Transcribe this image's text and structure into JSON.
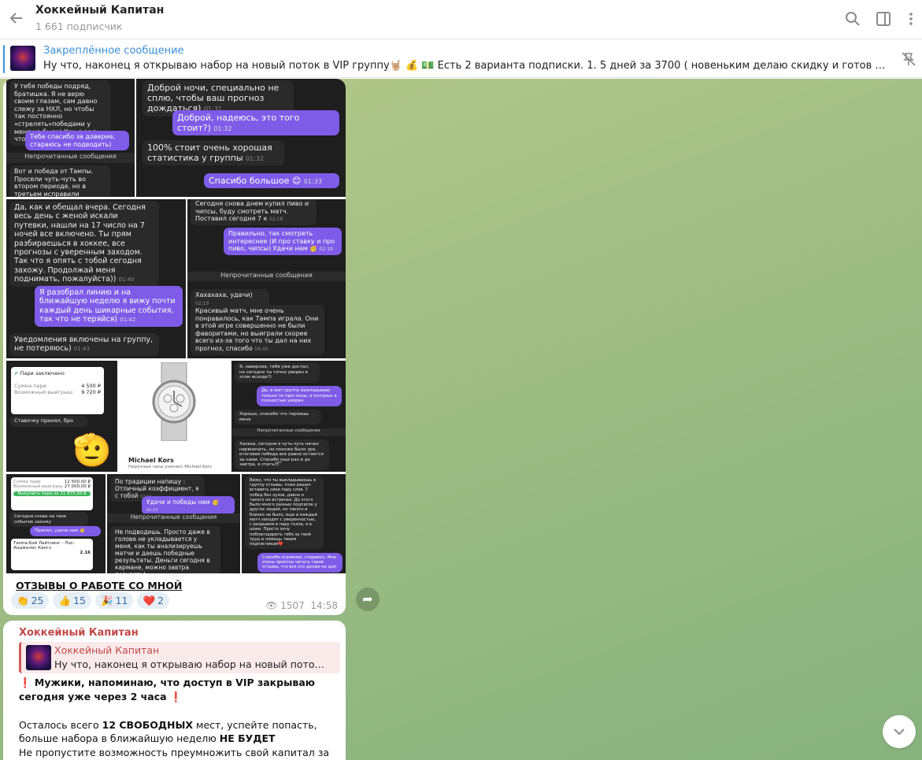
{
  "header": {
    "title": "Хоккейный Капитан",
    "subscribers": "1 661 подписчик"
  },
  "pinned": {
    "label": "Закреплённое сообщение",
    "text": "Ну что, наконец я открываю набор на новый поток в VIP группу🤘🏼 💰 💵 Есть 2 варианта подписки. 1. 5 дней за 3700 ( новеньким делаю скидку и готов дать доступ за ..."
  },
  "post1": {
    "shot1": {
      "texts": [
        "У тебя победы подряд, братишка. Я не верю своим глазам, сам давно слежу за НХЛ, но чтобы так постоянно «стрелять»победами у меня не было) Как я рад, что на тебя наткнулся)",
        "Тебе спасибо за доверие, стараюсь не подводить)",
        "Непрочитанные сообщения",
        "Вот и победа от Тампы. Просели чуть-чуть во втором периоде, но в третьем исправили ситуацию, благодарствую за прогноз"
      ]
    },
    "shot2": {
      "texts": [
        "Доброй ночи, специально не сплю, чтобы ваш прогноз дождаться)",
        "01:31",
        "Доброй, надеюсь, это того стоит?)",
        "01:32",
        "100% стоит очень хорошая статистика у группы",
        "01:32",
        "Спасибо большое 😊",
        "01:33"
      ]
    },
    "shot3": {
      "texts": [
        "Да, как и обещал вчера. Сегодня весь день с женой искали путевки, нашли на 17 число на 7 ночей все включено. Ты прям разбираешься в хоккее, все прогнозы с уверенным заходом. Так что я опять с тобой сегодня захожу. Продолжай меня поднимать, пожалуйста))",
        "01:40",
        "Я разобрал линию и на ближайшую неделю я вижу почти каждый день шикарные события, так что не теряйся)",
        "01:42",
        "Уведомления включены на группу, не потеряюсь)",
        "01:43"
      ]
    },
    "shot4": {
      "texts": [
        "Сегодня снова днем купил пиво и чипсы, буду смотреть матч. Поставил сегодня 7 к",
        "02:18",
        "Правильно, так смотреть интереснее (И про ставку и про пиво, чипсы) Удачи нам 🥳",
        "02:19",
        "Непрочитанные сообщения",
        "Хахахаха, удачи)",
        "02:19",
        "Красивый матч, мне очень понравилось, как Тампа играла. Они в этой игре совершенно не были фаворитами, но выиграли скорее всего из-за того что ты дал на них прогноз, спасибо",
        "06:40"
      ]
    },
    "shot5": {
      "texts": [
        "Пари заключено",
        "Сумма пари",
        "4 500 ₽",
        "Возможный выигрыш",
        "9 720 ₽",
        "Ставочку принял, бро"
      ]
    },
    "shot6": {
      "texts": [
        "Michael Kors",
        "Наручные часы унисекс Michael Kors"
      ]
    },
    "shot7": {
      "texts": [
        "Я, наверное, тебя уже достал, но сегодня ты точно уверен в этом исходе?)",
        "Да, в вип группу выкладываю только те прогнозы, в которых я полностью уверен",
        "Хорошо, спасибо что терпишь меня",
        "Непрочитанные сообщения",
        "Хахаха, сегодня я чуть-чуть начал нервничать, но похоже было зря, итоговая победа все равно остается за нами. Спасибо еще раз и до завтра, я спать😴"
      ]
    },
    "shot8": {
      "texts": [
        "Сумма пари",
        "12 500,00 ₽",
        "Возможный выигрыш",
        "27 000,00 ₽",
        "Выкупить пари за 11 875,00 ₽",
        "Сегодня снова на твое событие захожу",
        "Принял, удачи нам 🥳",
        "Тампа-Бэй Лайтнинг - Лос-Анджелес Кингз",
        "2.16"
      ]
    },
    "shot9": {
      "texts": [
        "По традиции напишу : Отличный коэффициент, я с тобой",
        "02:12",
        "Удачи и победы нам 🥳",
        "02:13",
        "Непрочитанные сообщения",
        "Не подводишь. Просто даже в голове не укладывается у меня, как ты анализируешь матчи и даешь победные результаты. Деньги сегодня в кармане, можно завтра погулять)"
      ]
    },
    "shot10": {
      "texts": [
        "Вижу, что ты выкладываешь в группу отзывы, тоже решил вставить свои пару слов. 7 побед без лузов, давно я такого не встречал. До этого было много разных подписок у других людей, но такого и близко не было, еще и каждый матч заходит с уверенностью, с разрывом в пару голов, я в шоке. Просто хочу поблагодарить тебя за твой труд и помощь твоим подписчикам❤️",
        "Спасибо огромное, стараюсь. Мне очень приятно читать такие отзывы, что все это делаю не зря)"
      ]
    },
    "caption": "ОТЗЫВЫ О РАБОТЕ СО МНОЙ",
    "reactions": [
      {
        "emoji": "👏",
        "count": "25"
      },
      {
        "emoji": "👍",
        "count": "15"
      },
      {
        "emoji": "🎉",
        "count": "11"
      },
      {
        "emoji": "❤️",
        "count": "2"
      }
    ],
    "views": "1507",
    "time": "14:58"
  },
  "post2": {
    "author": "Хоккейный Капитан",
    "reply_name": "Хоккейный Капитан",
    "reply_text": "Ну что, наконец я открываю набор на новый поток в ...",
    "line1": "❗ Мужики, напоминаю, что доступ в VIP закрываю сегодня уже через 2 часа ❗",
    "line2a": "Осталось всего ",
    "line2b": "12 СВОБОДНЫХ",
    "line2c": " мест, успейте попасть, больше набора в ближайшую неделю ",
    "line2d": "НЕ БУДЕТ",
    "line3": "Не пропустите возможность преумножить свой капитал за"
  },
  "colors": {
    "accent": "#3a8fd8",
    "out_bubble": "#7e5ce8",
    "author": "#c04a4a"
  },
  "icons": [
    "back-arrow-icon",
    "search-icon",
    "sidebar-icon",
    "more-icon",
    "unpin-icon",
    "eye-icon",
    "share-icon",
    "chevron-down-icon"
  ]
}
